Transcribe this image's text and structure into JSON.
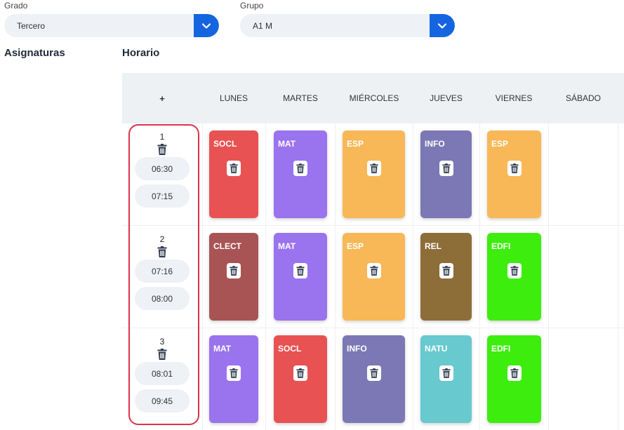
{
  "filters": {
    "grado": {
      "label": "Grado",
      "value": "Tercero"
    },
    "grupo": {
      "label": "Grupo",
      "value": "A1 M"
    }
  },
  "sections": {
    "asignaturas": "Asignaturas",
    "horario": "Horario"
  },
  "schedule": {
    "add_label": "+",
    "days": [
      "LUNES",
      "MARTES",
      "MIÉRCOLES",
      "JUEVES",
      "VIERNES",
      "SÁBADO"
    ],
    "periods": [
      {
        "number": "1",
        "start": "06:30",
        "end": "07:15"
      },
      {
        "number": "2",
        "start": "07:16",
        "end": "08:00"
      },
      {
        "number": "3",
        "start": "08:01",
        "end": "09:45"
      }
    ],
    "cells": [
      [
        {
          "code": "SOCL",
          "color": "#e85252"
        },
        {
          "code": "MAT",
          "color": "#9a73ef"
        },
        {
          "code": "ESP",
          "color": "#f8b857"
        },
        {
          "code": "INFO",
          "color": "#7b78b5"
        },
        {
          "code": "ESP",
          "color": "#f8b857"
        }
      ],
      [
        {
          "code": "CLECT",
          "color": "#a85454"
        },
        {
          "code": "MAT",
          "color": "#9a73ef"
        },
        {
          "code": "ESP",
          "color": "#f8b857"
        },
        {
          "code": "REL",
          "color": "#8d6d38"
        },
        {
          "code": "EDFI",
          "color": "#3ded0e"
        }
      ],
      [
        {
          "code": "MAT",
          "color": "#9a73ef"
        },
        {
          "code": "SOCL",
          "color": "#e85252"
        },
        {
          "code": "INFO",
          "color": "#7b78b5"
        },
        {
          "code": "NATU",
          "color": "#68c9cf"
        },
        {
          "code": "EDFI",
          "color": "#3ded0e"
        }
      ]
    ]
  },
  "icons": {
    "dropdown": "chevron-down-icon",
    "delete": "trash-icon"
  },
  "colors": {
    "accent": "#1565e0",
    "highlight": "#d9334a"
  }
}
